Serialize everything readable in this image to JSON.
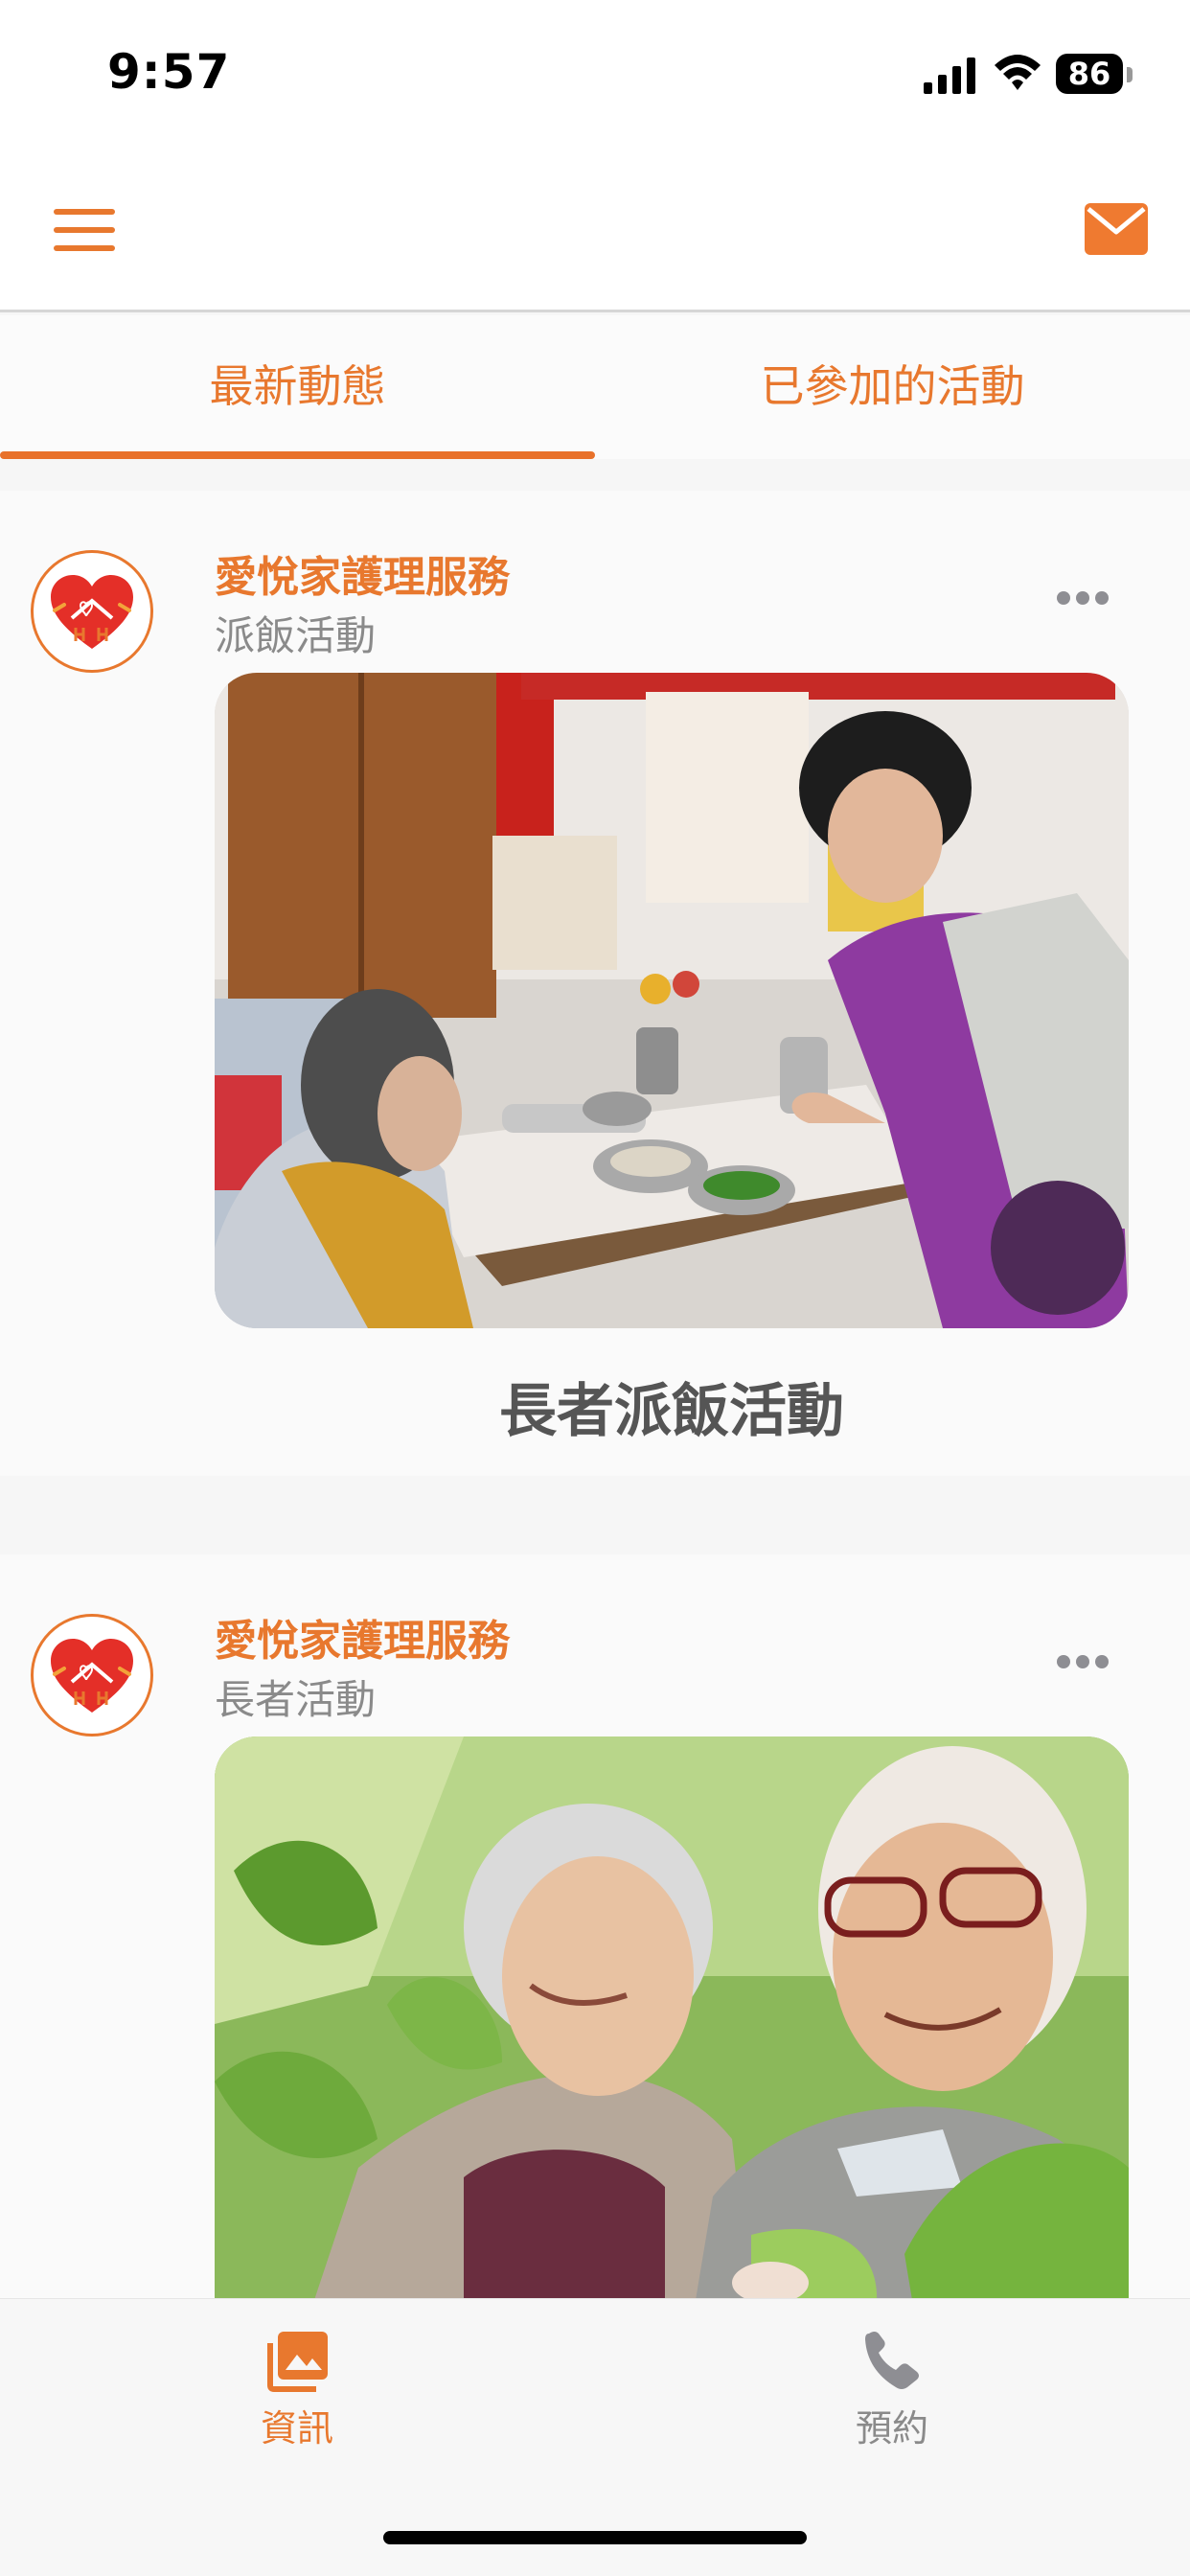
{
  "status_bar": {
    "time": "9:57",
    "battery": "86",
    "icons": [
      "cellular-signal-icon",
      "wifi-icon",
      "battery-icon"
    ]
  },
  "header": {
    "menu_icon": "hamburger-menu-icon",
    "mail_icon": "envelope-icon"
  },
  "tabs": [
    {
      "label": "最新動態",
      "active": true
    },
    {
      "label": "已參加的活動",
      "active": false
    }
  ],
  "feed": [
    {
      "org_name": "愛悅家護理服務",
      "category": "派飯活動",
      "image": "photo of a caregiver serving a meal to an elderly woman",
      "title": "長者派飯活動"
    },
    {
      "org_name": "愛悅家護理服務",
      "category": "長者活動",
      "image": "photo of a smiling elderly couple outdoors",
      "title": ""
    }
  ],
  "bottom_nav": [
    {
      "label": "資訊",
      "icon": "photo-library-icon",
      "active": true
    },
    {
      "label": "預約",
      "icon": "phone-icon",
      "active": false
    }
  ],
  "colors": {
    "accent": "#e8782e",
    "muted_text": "#8a8a8a",
    "title_text": "#555555",
    "background": "#f6f6f6"
  }
}
